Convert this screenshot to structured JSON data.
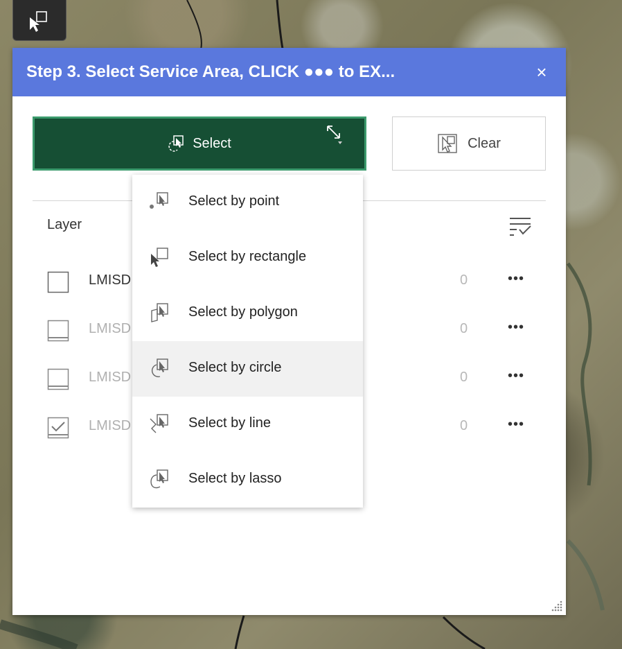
{
  "panel": {
    "title": "Step 3. Select Service Area, CLICK ●●● to EX...",
    "close_glyph": "×"
  },
  "toolbar": {
    "select_label": "Select",
    "clear_label": "Clear"
  },
  "layers": {
    "header": "Layer",
    "rows": [
      {
        "name": "LMISD",
        "count": "0",
        "more": "•••",
        "checked": false,
        "enabled": true
      },
      {
        "name": "LMISD",
        "count": "0",
        "more": "•••",
        "checked": false,
        "enabled": false
      },
      {
        "name": "LMISD",
        "count": "0",
        "more": "•••",
        "checked": false,
        "enabled": false
      },
      {
        "name": "LMISD",
        "count": "0",
        "more": "•••",
        "checked": true,
        "enabled": false
      }
    ]
  },
  "dropdown": {
    "items": [
      {
        "label": "Select by point",
        "icon": "select-point-icon"
      },
      {
        "label": "Select by rectangle",
        "icon": "select-rectangle-icon"
      },
      {
        "label": "Select by polygon",
        "icon": "select-polygon-icon"
      },
      {
        "label": "Select by circle",
        "icon": "select-circle-icon",
        "hovered": true
      },
      {
        "label": "Select by line",
        "icon": "select-line-icon"
      },
      {
        "label": "Select by lasso",
        "icon": "select-lasso-icon"
      }
    ]
  },
  "colors": {
    "header_bg": "#5a78dd",
    "select_bg": "#164f34",
    "select_border": "#3b9a6c"
  }
}
